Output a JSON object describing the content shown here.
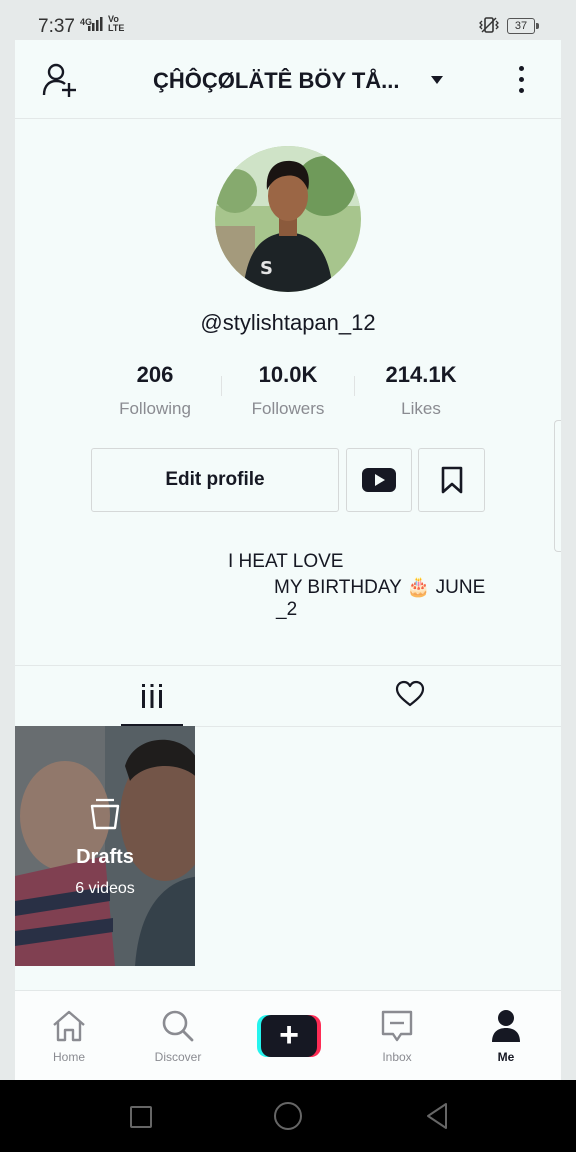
{
  "status_bar": {
    "time": "7:37",
    "network_type": "4G",
    "volte": "Vo\nLTE",
    "battery": "37"
  },
  "header": {
    "title": "ÇĤÔÇØLÄTÊ BÖY TÅ..."
  },
  "profile": {
    "username": "@stylishtapan_12",
    "stats": [
      {
        "value": "206",
        "label": "Following"
      },
      {
        "value": "10.0K",
        "label": "Followers"
      },
      {
        "value": "214.1K",
        "label": "Likes"
      }
    ],
    "edit_button": "Edit profile",
    "bio_lines": [
      "I HEAT LOVE",
      "MY BIRTHDAY 🎂 JUNE",
      "_2"
    ]
  },
  "drafts": {
    "label": "Drafts",
    "count": "6 videos"
  },
  "bottom_nav": {
    "items": [
      {
        "label": "Home",
        "icon": "home-icon"
      },
      {
        "label": "Discover",
        "icon": "search-icon"
      },
      {
        "label": "Inbox",
        "icon": "inbox-icon"
      },
      {
        "label": "Me",
        "icon": "person-icon"
      }
    ]
  },
  "colors": {
    "accent_red": "#fe2c55",
    "accent_cyan": "#25f4ee",
    "text_dark": "#161823",
    "text_gray": "#8a8b91"
  }
}
